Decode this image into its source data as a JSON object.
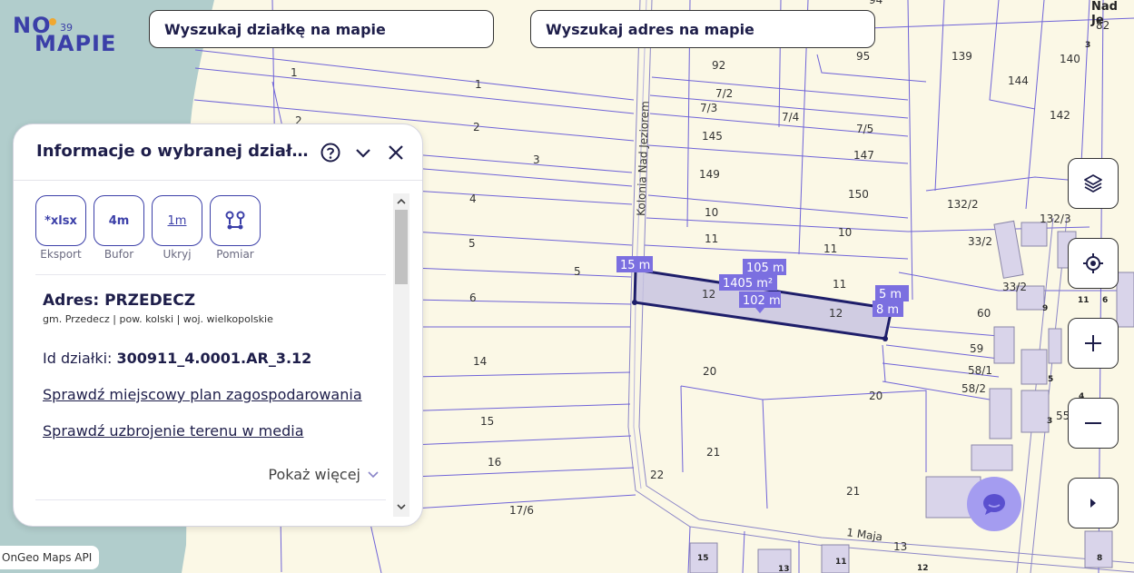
{
  "logo": {
    "line1": "NO",
    "line2": "MAPIE",
    "version": "39"
  },
  "search": {
    "parcel_placeholder": "Wyszukaj działkę na mapie",
    "address_placeholder": "Wyszukaj adres na mapie"
  },
  "panel": {
    "title": "Informacje o wybranej dział...",
    "tools": [
      {
        "icon_text": "*xlsx",
        "label": "Eksport"
      },
      {
        "icon_text": "4m",
        "label": "Bufor"
      },
      {
        "icon_text": "1m",
        "label": "Ukryj"
      },
      {
        "icon_text": "",
        "label": "Pomiar"
      }
    ],
    "address_title": "Adres: PRZEDECZ",
    "address_sub": "gm. Przedecz | pow. kolski | woj. wielkopolskie",
    "parcel_id_label": "Id działki: ",
    "parcel_id_value": "300911_4.0001.AR_3.12",
    "link_plan": "Sprawdź miejscowy plan zagospodarowania",
    "link_media": "Sprawdź uzbrojenie terenu w media",
    "show_more": "Pokaż więcej"
  },
  "map": {
    "street_label": "Nad Je",
    "road_label_vertical": "Kolonia Nad Jeziorem",
    "road_label_bottom": "1 Maja",
    "measurements": {
      "left_side": "15 m",
      "top_side": "105 m",
      "area": "1405 m²",
      "bottom_side": "102 m",
      "right_top": "5 m",
      "right_side": "8 m"
    },
    "parcel_numbers": [
      "94",
      "82",
      "92",
      "95",
      "139",
      "140",
      "3",
      "7/2",
      "7/3",
      "144",
      "7/4",
      "7/5",
      "142",
      "145",
      "147",
      "1",
      "1",
      "2",
      "2",
      "3",
      "149",
      "150",
      "132/2",
      "132/3",
      "4",
      "10",
      "10",
      "11",
      "11",
      "33/2",
      "5",
      "5",
      "11",
      "12",
      "12",
      "33/2",
      "6",
      "60",
      "59",
      "58/1",
      "58/2",
      "14",
      "20",
      "20",
      "15",
      "21",
      "22",
      "21",
      "16",
      "17/6",
      "13",
      "15",
      "13",
      "11",
      "12",
      "8",
      "11",
      "6",
      "9",
      "5",
      "4",
      "3",
      "55"
    ]
  },
  "attribution": "OnGeo Maps API",
  "colors": {
    "accent": "#3b3fa8",
    "water": "#b1cdcc",
    "land": "#fbf8e6",
    "parcel_line": "#6f63d8",
    "selected_fill": "#c8c4e0",
    "label_bg": "#7b6fe0"
  },
  "controls": [
    "layers-icon",
    "locate-icon",
    "zoom-in-icon",
    "zoom-out-icon",
    "expand-icon"
  ]
}
